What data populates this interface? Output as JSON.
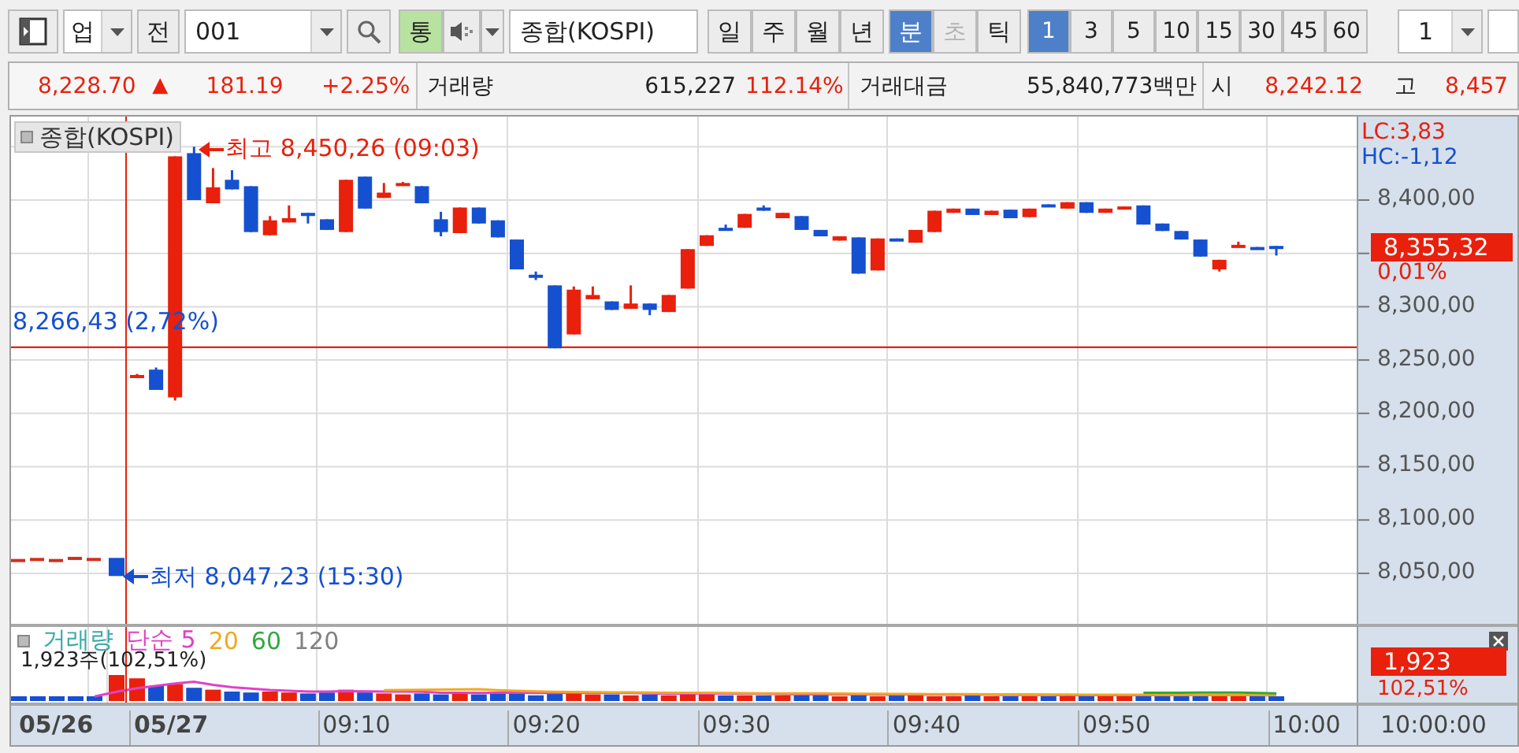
{
  "toolbar": {
    "market_type": {
      "value": "업"
    },
    "prev_button": {
      "label": "전"
    },
    "code": {
      "value": "001"
    },
    "sync_button": {
      "label": "통",
      "on": true
    },
    "name_field": {
      "value": "종합(KOSPI)"
    },
    "period_tabs": [
      {
        "label": "일",
        "selected": false
      },
      {
        "label": "주",
        "selected": false
      },
      {
        "label": "월",
        "selected": false
      },
      {
        "label": "년",
        "selected": false
      }
    ],
    "unit_tabs": [
      {
        "label": "분",
        "selected": true,
        "disabled": false
      },
      {
        "label": "초",
        "selected": false,
        "disabled": true
      },
      {
        "label": "틱",
        "selected": false,
        "disabled": false
      }
    ],
    "interval_tabs": [
      {
        "label": "1",
        "selected": true
      },
      {
        "label": "3",
        "selected": false
      },
      {
        "label": "5",
        "selected": false
      },
      {
        "label": "10",
        "selected": false
      },
      {
        "label": "15",
        "selected": false
      },
      {
        "label": "30",
        "selected": false
      },
      {
        "label": "45",
        "selected": false
      },
      {
        "label": "60",
        "selected": false
      }
    ],
    "count": {
      "value": "1"
    }
  },
  "quote_bar": {
    "price": "8,228.70",
    "direction": "▲",
    "change": "181.19",
    "change_rate": "+2.25%",
    "volume_label": "거래량",
    "volume": "615,227",
    "volume_rate": "112.14%",
    "amount_label": "거래대금",
    "amount": "55,840,773백만",
    "open_label": "시",
    "open": "8,242.12",
    "high_label": "고",
    "high": "8,457"
  },
  "price_chart": {
    "title": "종합(KOSPI)",
    "high_marker": "최고 8,450,26 (09:03)",
    "low_marker": "최저 8,047,23 (15:30)",
    "base_line_label": "8,266,43 (2,72%)",
    "lc": "LC:3,83",
    "hc": "HC:-1,12",
    "axis_labels": [
      "8,400,00",
      "8,300,00",
      "8,250,00",
      "8,200,00",
      "8,150,00",
      "8,100,00",
      "8,050,00"
    ],
    "current_price": "8,355,32",
    "current_rate": "0,01%"
  },
  "volume_chart": {
    "legend": [
      {
        "label": "거래량",
        "color": "#3aa8a8"
      },
      {
        "label": "단순 5",
        "color": "#e040c8"
      },
      {
        "label": "20",
        "color": "#f0a820"
      },
      {
        "label": "60",
        "color": "#30a840"
      },
      {
        "label": "120",
        "color": "#808080"
      }
    ],
    "readout": "1,923주(102,51%)",
    "current_volume": "1,923",
    "current_rate": "102,51%"
  },
  "time_axis": [
    {
      "label": "05/26",
      "kind": "date"
    },
    {
      "label": "05/27",
      "kind": "date"
    },
    {
      "label": "09:10",
      "kind": "time"
    },
    {
      "label": "09:20",
      "kind": "time"
    },
    {
      "label": "09:30",
      "kind": "time"
    },
    {
      "label": "09:40",
      "kind": "time"
    },
    {
      "label": "09:50",
      "kind": "time"
    },
    {
      "label": "10:00",
      "kind": "time"
    }
  ],
  "time_axis_right": "10:00:00"
}
